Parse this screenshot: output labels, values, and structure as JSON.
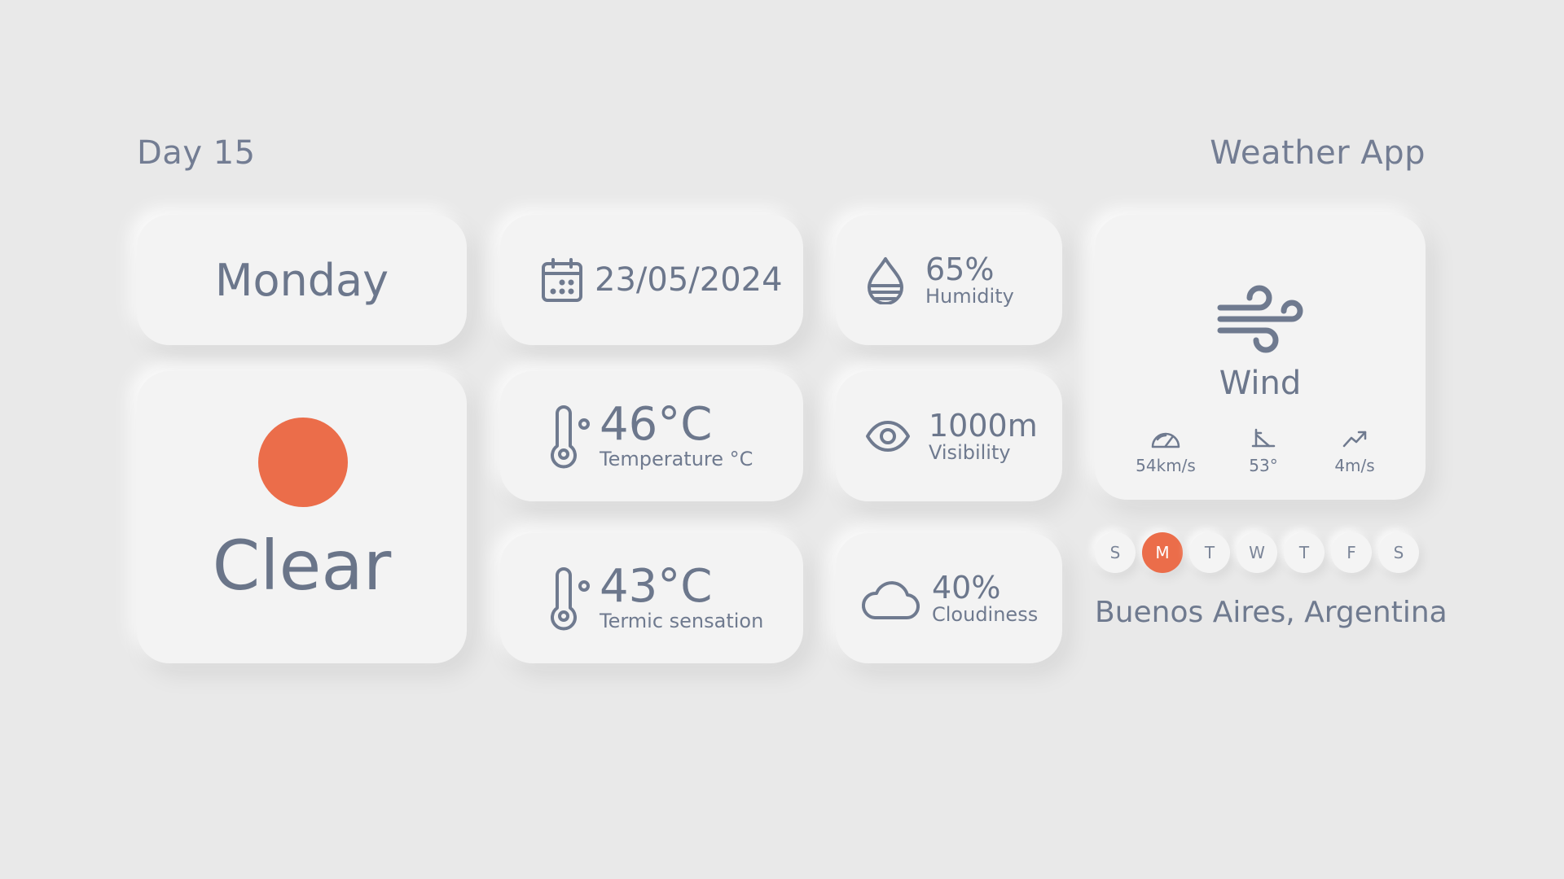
{
  "header": {
    "day_title": "Day 15",
    "app_title": "Weather App"
  },
  "day_card": {
    "weekday": "Monday"
  },
  "condition_card": {
    "label": "Clear",
    "icon": "sun-icon",
    "icon_color": "#EB6D4A"
  },
  "date_card": {
    "icon": "calendar-icon",
    "date": "23/05/2024"
  },
  "temperature_card": {
    "icon": "thermometer-icon",
    "value": "46°C",
    "label": "Temperature °C"
  },
  "termic_card": {
    "icon": "thermometer-icon",
    "value": "43°C",
    "label": "Termic sensation"
  },
  "humidity_card": {
    "icon": "water-drop-icon",
    "value": "65%",
    "label": "Humidity"
  },
  "visibility_card": {
    "icon": "eye-icon",
    "value": "1000m",
    "label": "Visibility"
  },
  "cloud_card": {
    "icon": "cloud-icon",
    "value": "40%",
    "label": "Cloudiness"
  },
  "wind_card": {
    "icon": "wind-icon",
    "label": "Wind",
    "stats": [
      {
        "icon": "speedometer-icon",
        "value": "54km/s"
      },
      {
        "icon": "angle-icon",
        "value": "53°"
      },
      {
        "icon": "trend-up-icon",
        "value": "4m/s"
      }
    ]
  },
  "week": {
    "days": [
      "S",
      "M",
      "T",
      "W",
      "T",
      "F",
      "S"
    ],
    "active_index": 1,
    "active_color": "#EB6D4A"
  },
  "location": "Buenos Aires, Argentina"
}
